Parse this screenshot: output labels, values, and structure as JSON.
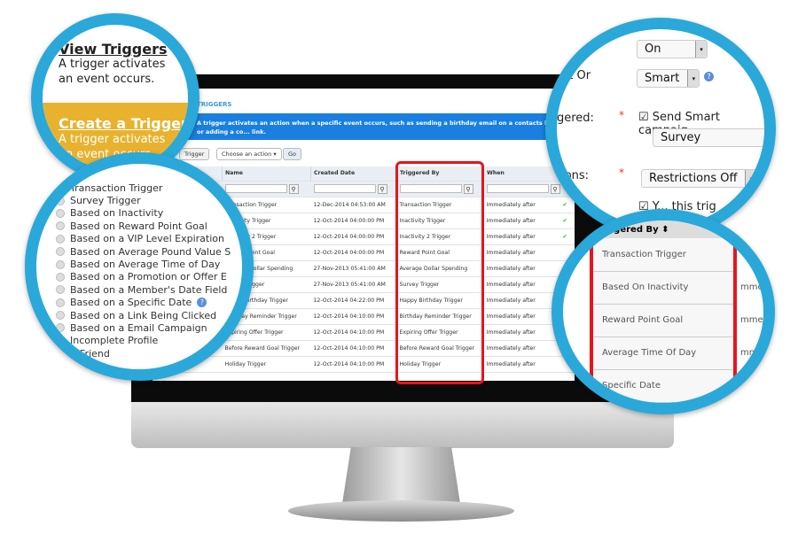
{
  "screen": {
    "title": "TRIGGERS",
    "banner": "A trigger activates an action when a specific event occurs, such as sending a birthday email on a contacts birthday or adding a co... link.",
    "add_button": "Trigger",
    "action_select": "Choose an action",
    "go_button": "Go",
    "columns": [
      "",
      "",
      "Name",
      "Created Date",
      "Triggered By",
      "When",
      ""
    ],
    "rows": [
      {
        "name": "Transaction Trigger",
        "created": "12-Dec-2014 04:53:00 AM",
        "triggered_by": "Transaction Trigger",
        "when": "Immediately after",
        "active": true
      },
      {
        "name": "Inactivity Trigger",
        "created": "12-Oct-2014 04:00:00 PM",
        "triggered_by": "Inactivity Trigger",
        "when": "Immediately after",
        "active": true
      },
      {
        "name": "Inactivity 2 Trigger",
        "created": "12-Oct-2014 04:00:00 PM",
        "triggered_by": "Inactivity 2 Trigger",
        "when": "Immediately after",
        "active": true
      },
      {
        "name": "Reward Point Goal",
        "created": "12-Oct-2014 04:00:00 PM",
        "triggered_by": "Reward Point Goal",
        "when": "Immediately after",
        "active": false
      },
      {
        "name": "Average Dollar Spending",
        "created": "27-Nov-2013 05:41:00 AM",
        "triggered_by": "Average Dollar Spending",
        "when": "Immediately after",
        "active": false
      },
      {
        "name": "Survey Trigger",
        "created": "27-Nov-2013 05:41:00 AM",
        "triggered_by": "Survey Trigger",
        "when": "Immediately after",
        "active": false
      },
      {
        "name": "Happy Birthday Trigger",
        "created": "12-Oct-2014 04:22:00 PM",
        "triggered_by": "Happy Birthday Trigger",
        "when": "Immediately after",
        "active": false
      },
      {
        "name": "Birthday Reminder Trigger",
        "created": "12-Oct-2014 04:10:00 PM",
        "triggered_by": "Birthday Reminder Trigger",
        "when": "Immediately after",
        "active": false
      },
      {
        "name": "Expiring Offer Trigger",
        "created": "12-Oct-2014 04:10:00 PM",
        "triggered_by": "Expiring Offer Trigger",
        "when": "Immediately after",
        "active": false
      },
      {
        "name": "Before Reward Goal Trigger",
        "created": "12-Oct-2014 04:10:00 PM",
        "triggered_by": "Before Reward Goal Trigger",
        "when": "Immediately after",
        "active": false
      },
      {
        "name": "Holiday Trigger",
        "created": "12-Oct-2014 04:10:00 PM",
        "triggered_by": "Holiday Trigger",
        "when": "Immediately after",
        "active": false
      }
    ]
  },
  "zoom_menu": {
    "view_title": "View Triggers",
    "view_desc": "A trigger activates an event occurs.",
    "create_title": "Create a Trigger",
    "create_desc": "A trigger activates an event occurs.",
    "accent": "#e8b22e"
  },
  "zoom_types": [
    "Transaction Trigger",
    "Survey Trigger",
    "Based on Inactivity",
    "Based on Reward Point Goal",
    "Based on a VIP Level Expiration",
    "Based on Average Pound Value S",
    "Based on Average Time of Day",
    "Based on a Promotion or Offer E",
    "Based on a Member's Date Field",
    "Based on a Specific Date",
    "Based on a Link Being Clicked",
    "Based on a Email Campaign",
    "Incomplete Profile",
    "A Friend"
  ],
  "zoom_form": {
    "status_value": "On",
    "smart_label": "art Or",
    "smart_value": "Smart",
    "triggered_label": "gered:",
    "send_smart": "Send Smart campaig",
    "campaign_value": "Survey",
    "restrictions_label": "tions:",
    "restrictions_value": "Restrictions Off",
    "last_label": "Y... this trig"
  },
  "zoom_column": {
    "header": "ggered By",
    "items": [
      "Transaction Trigger",
      "Based On Inactivity",
      "Reward Point Goal",
      "Average Time Of Day",
      "Specific Date"
    ],
    "partial": "mme"
  },
  "colors": {
    "ring": "#2aa8d9",
    "highlight": "#e8141b",
    "banner": "#1a7fe0"
  }
}
